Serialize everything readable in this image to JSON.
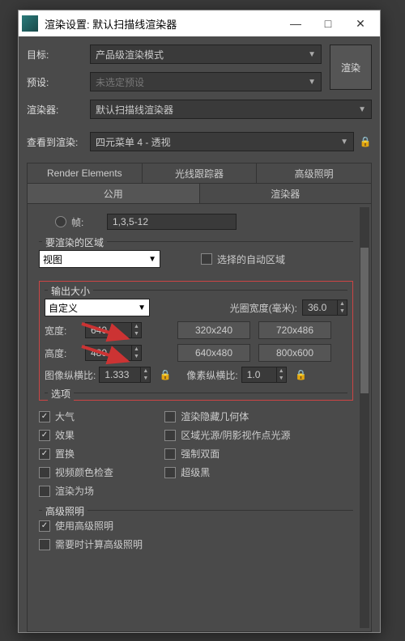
{
  "window": {
    "title": "渲染设置: 默认扫描线渲染器"
  },
  "top": {
    "target_label": "目标:",
    "target_value": "产品级渲染模式",
    "preset_label": "预设:",
    "preset_value": "未选定预设",
    "renderer_label": "渲染器:",
    "renderer_value": "默认扫描线渲染器",
    "viewto_label": "查看到渲染:",
    "viewto_value": "四元菜单 4 - 透视",
    "render_btn": "渲染"
  },
  "tabs": {
    "row1": [
      "Render Elements",
      "光线跟踪器",
      "高级照明"
    ],
    "row2": [
      "公用",
      "渲染器"
    ],
    "active": "公用"
  },
  "frames": {
    "radio_label": "帧:",
    "value": "1,3,5-12"
  },
  "area": {
    "group": "要渲染的区域",
    "select": "视图",
    "auto_label": "选择的自动区域"
  },
  "output": {
    "group": "输出大小",
    "custom": "自定义",
    "aperture_label": "光圈宽度(毫米):",
    "aperture_value": "36.0",
    "width_label": "宽度:",
    "width_value": "640",
    "height_label": "高度:",
    "height_value": "480",
    "presets": [
      "320x240",
      "720x486",
      "640x480",
      "800x600"
    ],
    "img_aspect_label": "图像纵横比:",
    "img_aspect_value": "1.333",
    "px_aspect_label": "像素纵横比:",
    "px_aspect_value": "1.0"
  },
  "options": {
    "group": "选项",
    "items": [
      {
        "label": "大气",
        "checked": true,
        "side": "left"
      },
      {
        "label": "渲染隐藏几何体",
        "checked": false,
        "side": "right"
      },
      {
        "label": "效果",
        "checked": true,
        "side": "left"
      },
      {
        "label": "区域光源/阴影视作点光源",
        "checked": false,
        "side": "right"
      },
      {
        "label": "置换",
        "checked": true,
        "side": "left"
      },
      {
        "label": "强制双面",
        "checked": false,
        "side": "right"
      },
      {
        "label": "视频颜色检查",
        "checked": false,
        "side": "left"
      },
      {
        "label": "超级黑",
        "checked": false,
        "side": "right"
      },
      {
        "label": "渲染为场",
        "checked": false,
        "side": "left"
      }
    ]
  },
  "adv": {
    "group": "高级照明",
    "use_label": "使用高级照明",
    "compute_label": "需要时计算高级照明"
  }
}
